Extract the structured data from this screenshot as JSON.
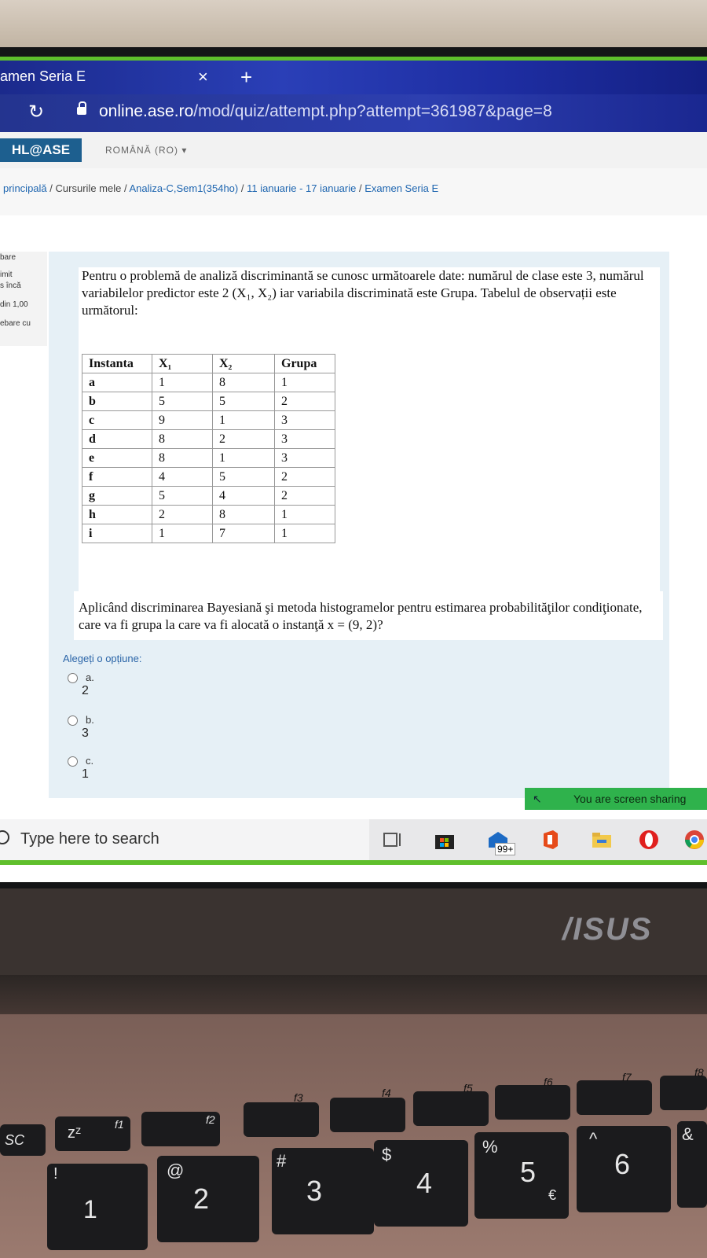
{
  "browser": {
    "tab_title": "amen Seria E",
    "tab_close": "×",
    "new_tab": "+",
    "reload_icon": "↻",
    "url_host": "online.ase.ro",
    "url_path": "/mod/quiz/attempt.php?attempt=361987&page=8"
  },
  "site": {
    "brand": "HL@ASE",
    "language": "ROMÂNĂ (RO)",
    "language_caret": "▾"
  },
  "breadcrumb": [
    "principală",
    "Cursurile mele",
    "Analiza-C,Sem1(354ho)",
    "11 ianuarie - 17 ianuarie",
    "Examen Seria E"
  ],
  "breadcrumb_sep": "/",
  "question_info": {
    "state_line1": "bare",
    "state_line2": "imit",
    "state_line3": "s încă",
    "marks": "din 1,00",
    "flag": "ebare cu"
  },
  "question": {
    "intro": "Pentru o problemă de analiză discriminantă se cunosc următoarele date: numărul de clase este 3, numărul variabilelor predictor este 2 (X₁, X₂) iar variabila discriminată este Grupa. Tabelul de observații este următorul:",
    "table_headers": [
      "Instanta",
      "X₁",
      "X₂",
      "Grupa"
    ],
    "table_rows": [
      [
        "a",
        "1",
        "8",
        "1"
      ],
      [
        "b",
        "5",
        "5",
        "2"
      ],
      [
        "c",
        "9",
        "1",
        "3"
      ],
      [
        "d",
        "8",
        "2",
        "3"
      ],
      [
        "e",
        "8",
        "1",
        "3"
      ],
      [
        "f",
        "4",
        "5",
        "2"
      ],
      [
        "g",
        "5",
        "4",
        "2"
      ],
      [
        "h",
        "2",
        "8",
        "1"
      ],
      [
        "i",
        "1",
        "7",
        "1"
      ]
    ],
    "text": "Aplicând discriminarea Bayesiană şi metoda histogramelor pentru estimarea probabilităţilor condiţionate, care va fi grupa la care va fi alocată o instanţă x = (9, 2)?",
    "prompt": "Alegeți o opțiune:",
    "options": [
      {
        "letter": "a.",
        "value": "2"
      },
      {
        "letter": "b.",
        "value": "3"
      },
      {
        "letter": "c.",
        "value": "1"
      }
    ]
  },
  "screen_share": {
    "arrow": "↖",
    "label": "You are screen sharing"
  },
  "taskbar": {
    "search_placeholder": "Type here to search",
    "mail_badge": "99+"
  },
  "laptop": {
    "brand": "/ISUS",
    "keys": {
      "esc": "SC",
      "z_label": "zᶻ",
      "f1": "f1",
      "f2": "f2",
      "f3": "f3",
      "f4": "f4",
      "f5": "f5",
      "f6": "f6",
      "f7": "f7",
      "f8": "f8",
      "n1": "1",
      "n1_sym": "!",
      "n2": "2",
      "n2_sym": "@",
      "n3": "3",
      "n3_sym": "#",
      "n4": "4",
      "n4_sym": "$",
      "n5": "5",
      "n5_sym": "%",
      "n5_alt": "€",
      "n6": "6",
      "n6_sym": "^",
      "n7_sym": "&"
    }
  }
}
